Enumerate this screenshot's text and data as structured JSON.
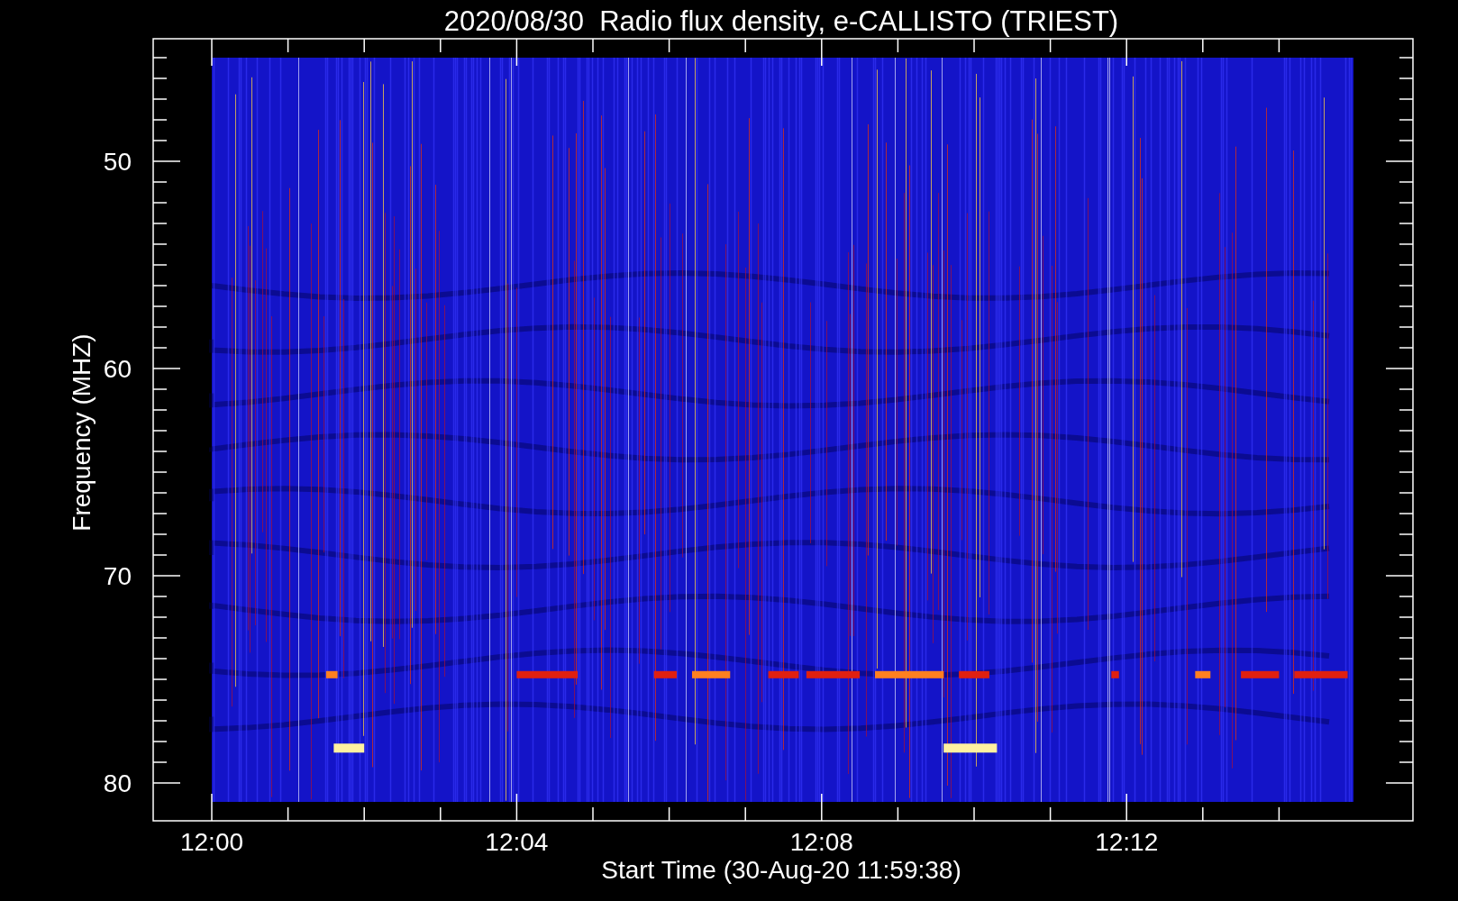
{
  "title": "2020/08/30  Radio flux density, e-CALLISTO (TRIEST)",
  "y_axis": {
    "title": "Frequency (MHZ)",
    "ticks": [
      "50",
      "60",
      "70",
      "80"
    ]
  },
  "x_axis": {
    "title": "Start Time (30-Aug-20 11:59:38)",
    "ticks": [
      "12:00",
      "12:04",
      "12:08",
      "12:12"
    ]
  }
}
